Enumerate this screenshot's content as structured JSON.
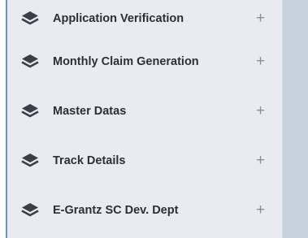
{
  "sidebar": {
    "items": [
      {
        "label": "Application Verification",
        "icon": "layers-icon",
        "expand": "+"
      },
      {
        "label": "Monthly Claim Generation",
        "icon": "layers-icon",
        "expand": "+"
      },
      {
        "label": "Master Datas",
        "icon": "layers-icon",
        "expand": "+"
      },
      {
        "label": "Track Details",
        "icon": "layers-icon",
        "expand": "+"
      },
      {
        "label": "E-Grantz SC Dev. Dept",
        "icon": "layers-icon",
        "expand": "+"
      }
    ]
  },
  "colors": {
    "sidebar_bg": "#e9ebf1",
    "page_bg": "#c8d2df",
    "accent_line": "#6b93c9",
    "label_text": "#2b2f36",
    "icon": "#3a3f47",
    "plus": "#8b8f96"
  }
}
